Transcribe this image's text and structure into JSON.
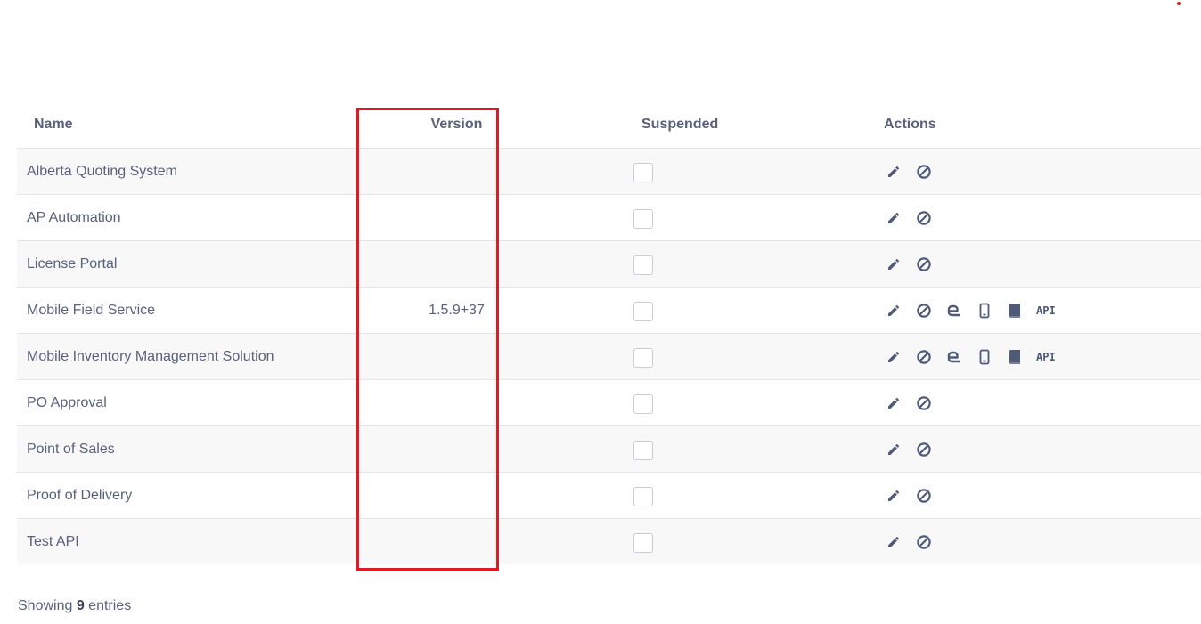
{
  "table": {
    "headers": {
      "name": "Name",
      "version": "Version",
      "suspended": "Suspended",
      "actions": "Actions"
    },
    "rows": [
      {
        "name": "Alberta Quoting System",
        "version": "",
        "suspended": false,
        "actions": [
          "edit",
          "suspend"
        ]
      },
      {
        "name": "AP Automation",
        "version": "",
        "suspended": false,
        "actions": [
          "edit",
          "suspend"
        ]
      },
      {
        "name": "License Portal",
        "version": "",
        "suspended": false,
        "actions": [
          "edit",
          "suspend"
        ]
      },
      {
        "name": "Mobile Field Service",
        "version": "1.5.9+37",
        "suspended": false,
        "actions": [
          "edit",
          "suspend",
          "link",
          "mobile",
          "book",
          "api"
        ]
      },
      {
        "name": "Mobile Inventory Management Solution",
        "version": "",
        "suspended": false,
        "actions": [
          "edit",
          "suspend",
          "link",
          "mobile",
          "book",
          "api"
        ]
      },
      {
        "name": "PO Approval",
        "version": "",
        "suspended": false,
        "actions": [
          "edit",
          "suspend"
        ]
      },
      {
        "name": "Point of Sales",
        "version": "",
        "suspended": false,
        "actions": [
          "edit",
          "suspend"
        ]
      },
      {
        "name": "Proof of Delivery",
        "version": "",
        "suspended": false,
        "actions": [
          "edit",
          "suspend"
        ]
      },
      {
        "name": "Test API",
        "version": "",
        "suspended": false,
        "actions": [
          "edit",
          "suspend"
        ]
      }
    ],
    "api_label": "API"
  },
  "footer": {
    "prefix": "Showing ",
    "count": "9",
    "suffix": " entries"
  },
  "colors": {
    "text": "#58617a",
    "icon": "#4e5a78",
    "highlight": "#e01b22",
    "row_stripe": "#f8f8f9"
  }
}
